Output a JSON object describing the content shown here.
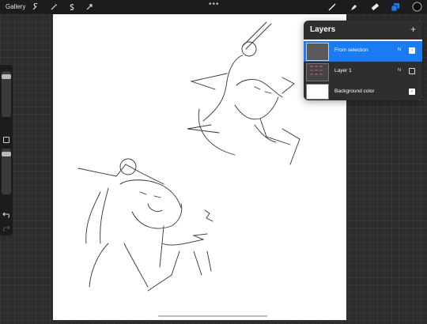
{
  "topbar": {
    "gallery_label": "Gallery",
    "left_tools": [
      "wrench-icon",
      "magic-wand-icon",
      "selection-icon",
      "transform-arrow-icon"
    ],
    "right_tools": [
      "brush-icon",
      "smudge-icon",
      "eraser-icon",
      "layers-icon",
      "color-picker-icon"
    ],
    "accent": "#1a7cf5"
  },
  "layers_panel": {
    "title": "Layers",
    "add_icon": "plus-icon",
    "layers": [
      {
        "name": "From selection",
        "blend": "N",
        "visible": true,
        "selected": true
      },
      {
        "name": "Layer 1",
        "blend": "N",
        "visible": false,
        "selected": false
      },
      {
        "name": "Background color",
        "blend": "",
        "visible": true,
        "selected": false
      }
    ]
  },
  "sidebar": {
    "tools": [
      "brush-size-slider",
      "modify-button",
      "opacity-slider",
      "undo-icon",
      "redo-icon"
    ]
  }
}
